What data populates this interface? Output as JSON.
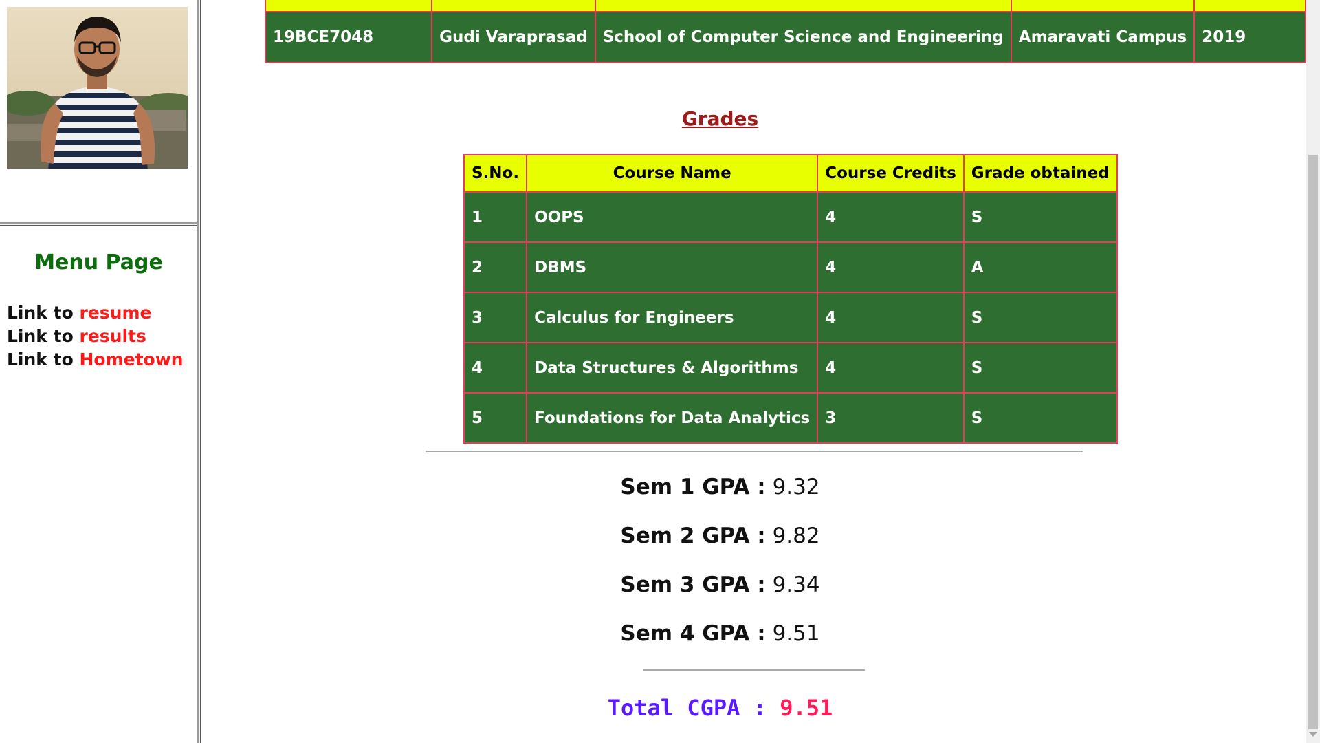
{
  "sidebar": {
    "menu_title": "Menu Page",
    "links": [
      {
        "prefix": "Link to",
        "label": "resume"
      },
      {
        "prefix": "Link to",
        "label": "results"
      },
      {
        "prefix": "Link to",
        "label": "Hometown"
      }
    ]
  },
  "student": {
    "row": [
      "19BCE7048",
      "Gudi Varaprasad",
      "School of Computer Science and Engineering",
      "Amaravati Campus",
      "2019"
    ]
  },
  "grades": {
    "heading": "Grades",
    "headers": [
      "S.No.",
      "Course Name",
      "Course Credits",
      "Grade obtained"
    ],
    "rows": [
      [
        "1",
        "OOPS",
        "4",
        "S"
      ],
      [
        "2",
        "DBMS",
        "4",
        "A"
      ],
      [
        "3",
        "Calculus for Engineers",
        "4",
        "S"
      ],
      [
        "4",
        "Data Structures & Algorithms",
        "4",
        "S"
      ],
      [
        "5",
        "Foundations for Data Analytics",
        "3",
        "S"
      ]
    ]
  },
  "gpa": [
    {
      "label": "Sem 1 GPA :",
      "value": "9.32"
    },
    {
      "label": "Sem 2 GPA :",
      "value": "9.82"
    },
    {
      "label": "Sem 3 GPA :",
      "value": "9.34"
    },
    {
      "label": "Sem 4 GPA :",
      "value": "9.51"
    }
  ],
  "cgpa": {
    "label": "Total CGPA :",
    "value": "9.51"
  },
  "colors": {
    "header_bg": "#e8ff00",
    "cell_bg": "#2e6e30",
    "table_border": "#e83a5a",
    "menu_title": "#0b6d0b",
    "link": "#ff1a1a",
    "grades_heading": "#a11a1a",
    "cgpa_label": "#5a1aff",
    "cgpa_value": "#ff1a5a"
  }
}
